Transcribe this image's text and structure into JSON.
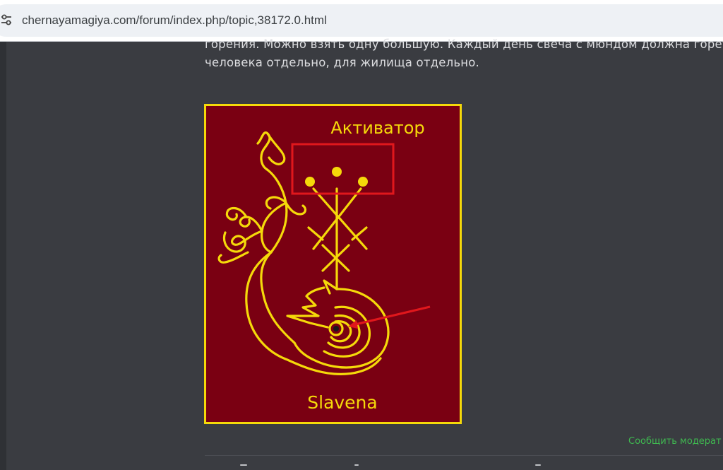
{
  "browser": {
    "url": "chernayamagiya.com/forum/index.php/topic,38172.0.html"
  },
  "post": {
    "lines": [
      "горения. Можно взять одну большую. Каждый день свеча с мюндом должна гореть",
      "человека отдельно, для жилища отдельно."
    ]
  },
  "image": {
    "top_label": "Активатор",
    "bottom_label": "Slavena"
  },
  "footer": {
    "report_link": "Сообщить модерат"
  },
  "colors": {
    "page_bg": "#3a3c41",
    "image_bg": "#7a0012",
    "image_ink": "#f5d90a",
    "highlight": "#e0171c",
    "link": "#3fb950"
  }
}
